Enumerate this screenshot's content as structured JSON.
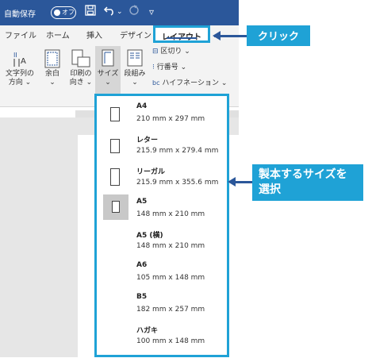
{
  "titlebar": {
    "autosave_label": "自動保存",
    "toggle_state": "オフ",
    "qat_more": "▿"
  },
  "tabs": [
    {
      "label": "ファイル"
    },
    {
      "label": "ホーム"
    },
    {
      "label": "挿入"
    },
    {
      "label": "デザイン"
    }
  ],
  "layout_tab": {
    "label": "レイアウト"
  },
  "callout_click": "クリック",
  "callout_select": {
    "line1": "製本するサイズを",
    "line2": "選択"
  },
  "ribbon": {
    "text_direction": {
      "line1": "文字列の",
      "line2": "方向 ⌄"
    },
    "margins": {
      "line1": "余白",
      "line2": "⌄"
    },
    "orientation": {
      "line1": "印刷の",
      "line2": "向き ⌄"
    },
    "size": {
      "line1": "サイズ",
      "line2": "⌄"
    },
    "columns": {
      "line1": "段組み",
      "line2": "⌄"
    },
    "breaks": "区切り ⌄",
    "line_numbers": "行番号 ⌄",
    "hyphenation": "ハイフネーション ⌄"
  },
  "size_menu": {
    "items": [
      {
        "name": "A4",
        "dims": "210 mm x 297 mm"
      },
      {
        "name": "レター",
        "dims": "215.9 mm x 279.4 mm"
      },
      {
        "name": "リーガル",
        "dims": "215.9 mm x 355.6 mm"
      },
      {
        "name": "A5",
        "dims": "148 mm x 210 mm"
      },
      {
        "name": "A5 (横)",
        "dims": "148 mm x 210 mm"
      },
      {
        "name": "A6",
        "dims": "105 mm x 148 mm"
      },
      {
        "name": "B5",
        "dims": "182 mm x 257 mm"
      },
      {
        "name": "ハガキ",
        "dims": "100 mm x 148 mm"
      }
    ],
    "selected": "A5"
  }
}
